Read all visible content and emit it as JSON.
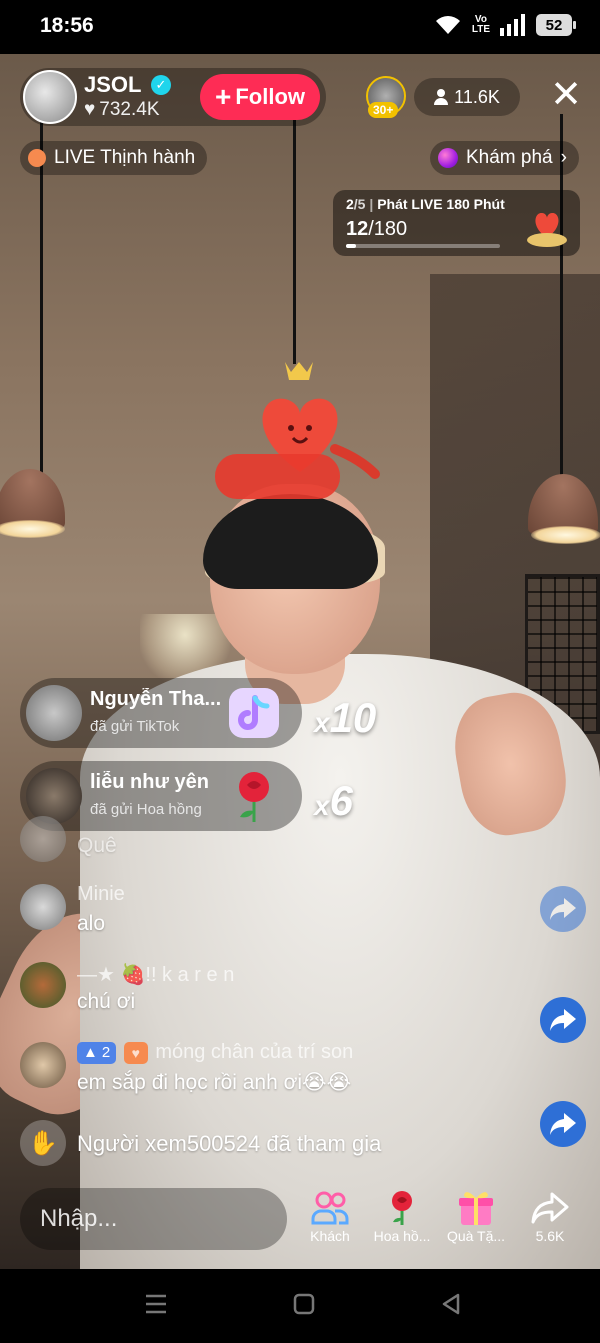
{
  "status_bar": {
    "time": "18:56",
    "volte_top": "Vo",
    "volte_bottom": "LTE",
    "battery": "52"
  },
  "host": {
    "name": "JSOL",
    "likes": "732.4K",
    "follow_label": "Follow"
  },
  "top_right": {
    "top_viewer_badge": "30+",
    "viewer_count": "11.6K"
  },
  "chips": {
    "live_trending": "LIVE Thịnh hành",
    "explore": "Khám phá"
  },
  "mission": {
    "step": "2",
    "step_total": "/5",
    "title": "Phát LIVE 180 Phút",
    "progress_value": "12",
    "progress_total": "/180",
    "progress_fraction": 0.067
  },
  "gifts": [
    {
      "user": "Nguyễn Tha...",
      "action": "đã gửi TikTok",
      "count_prefix": "x",
      "count": "10"
    },
    {
      "user": "liễu như yên",
      "action": "đã gửi Hoa hồng",
      "count_prefix": "x",
      "count": "6"
    }
  ],
  "comments": [
    {
      "user": "",
      "text": "Quê"
    },
    {
      "user": "Minie",
      "text": "alo"
    },
    {
      "user": "—★ 🍓!! k a r e n",
      "text": "chú ơi"
    },
    {
      "user": "móng chân của trí son",
      "rank": "2",
      "text": "em sắp đi học rồi anh ơi😭😭"
    }
  ],
  "join_message": "Người xem500524 đã tham gia",
  "input": {
    "placeholder": "Nhập..."
  },
  "bottom_actions": {
    "guests": "Khách",
    "rose": "Hoa hồ...",
    "gift": "Quà Tặ...",
    "share": "5.6K"
  },
  "colors": {
    "follow": "#fe2c55",
    "accent_blue": "#2e6fd6",
    "tag_orange": "#f68a4f",
    "badge_gold": "#f2c100"
  },
  "icons": [
    "wifi-icon",
    "signal-icon",
    "battery-icon",
    "verified-icon",
    "heart-icon",
    "person-icon",
    "close-icon",
    "chevron-right-icon",
    "share-icon",
    "guests-icon",
    "rose-icon",
    "gift-icon",
    "wave-hand-icon",
    "menu-nav-icon",
    "home-nav-icon",
    "back-nav-icon"
  ]
}
